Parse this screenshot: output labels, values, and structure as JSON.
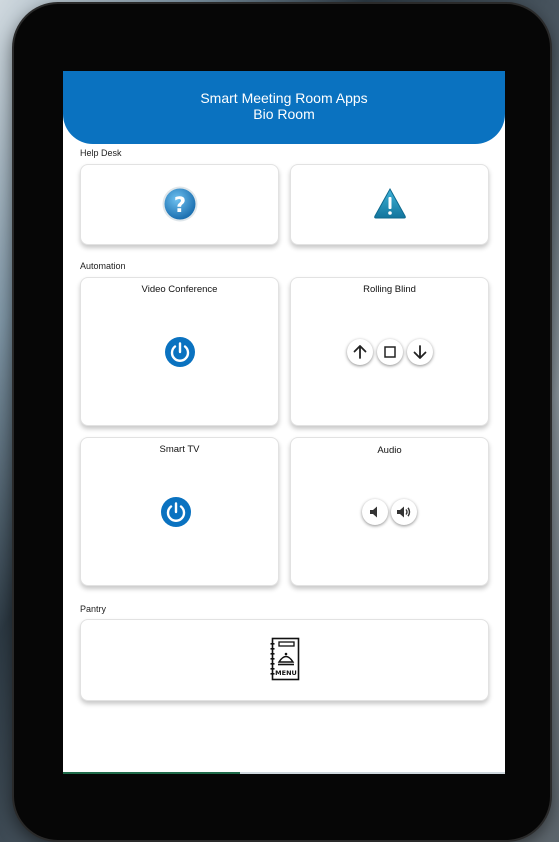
{
  "header": {
    "title": "Smart Meeting Room Apps",
    "subtitle": "Bio Room"
  },
  "sections": {
    "help_desk": "Help Desk",
    "automation": "Automation",
    "pantry": "Pantry"
  },
  "cards": {
    "video_conference": "Video Conference",
    "rolling_blind": "Rolling Blind",
    "smart_tv": "Smart TV",
    "audio": "Audio"
  },
  "icons": {
    "help": "question-icon",
    "alert": "warning-icon",
    "power": "power-icon",
    "up": "arrow-up-icon",
    "stop": "stop-icon",
    "down": "arrow-down-icon",
    "vol_down": "volume-down-icon",
    "vol_up": "volume-up-icon",
    "menu": "menu-icon"
  },
  "menu_icon_text": "MENU",
  "colors": {
    "accent": "#0a72c0",
    "help_blue": "#2e8fd0",
    "warning_teal": "#1f8fb5"
  }
}
